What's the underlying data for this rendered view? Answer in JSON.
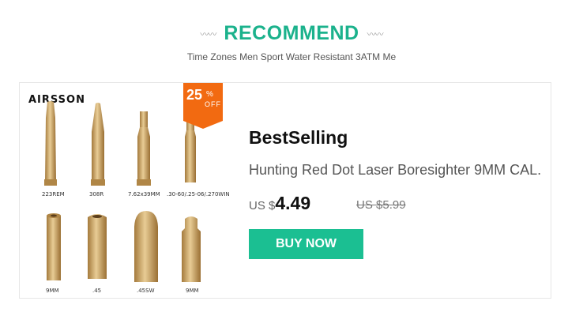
{
  "header": {
    "title": "RECOMMEND",
    "decoration_left": "〰〰",
    "decoration_right": "〰〰",
    "subtitle": "Time Zones Men Sport Water Resistant 3ATM Me"
  },
  "product": {
    "brand": "AIRSSON",
    "discount": {
      "value": "25",
      "percent": "%",
      "off": "OFF"
    },
    "captions": [
      "223REM",
      "308R",
      "7.62x39MM",
      ".30-60/.25-06/.270WIN",
      "9MM",
      ".45",
      ".45SW",
      "9MM"
    ],
    "badge_label": "BestSelling",
    "name": "Hunting Red Dot Laser Boresighter 9MM CAL.",
    "currency": "US $",
    "price": "4.49",
    "old_price": "US $5.99",
    "buy_label": "BUY NOW"
  },
  "colors": {
    "accent": "#1bb28c",
    "button": "#1bbf92",
    "discount_badge": "#f26a11",
    "brass": "#c8a064"
  }
}
